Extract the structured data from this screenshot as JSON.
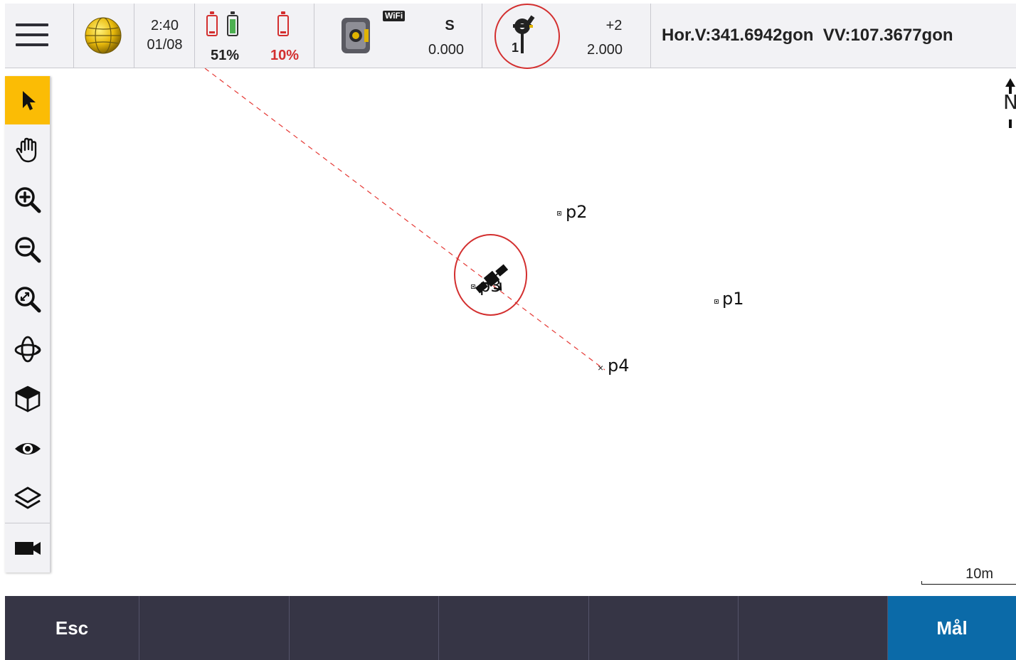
{
  "status": {
    "time": "2:40",
    "date": "01/08",
    "battery_left_pct": "51%",
    "battery_right_pct": "10%",
    "wifi_label": "WiFi",
    "target_mode": "S",
    "target_value": "0.000",
    "prism_number": "1",
    "prism_constant": "+2",
    "target_height": "2.000",
    "angles": "Hor.V:341.6942gon  VV:107.3677gon"
  },
  "map": {
    "points": [
      {
        "name": "p2"
      },
      {
        "name": "p3"
      },
      {
        "name": "p1"
      },
      {
        "name": "p4"
      }
    ],
    "north_label": "N",
    "scale_label": "10m"
  },
  "toolbar": {
    "tools": [
      "select",
      "pan",
      "zoom-in",
      "zoom-out",
      "zoom-extents",
      "orbit",
      "3d-view",
      "visibility",
      "layers",
      "camera"
    ]
  },
  "softkeys": {
    "esc": "Esc",
    "primary": "Mål"
  },
  "colors": {
    "accent": "#fbbc05",
    "primary_button": "#0b6aa8",
    "bottom_bar": "#363545",
    "alert_red": "#d32f2f"
  }
}
